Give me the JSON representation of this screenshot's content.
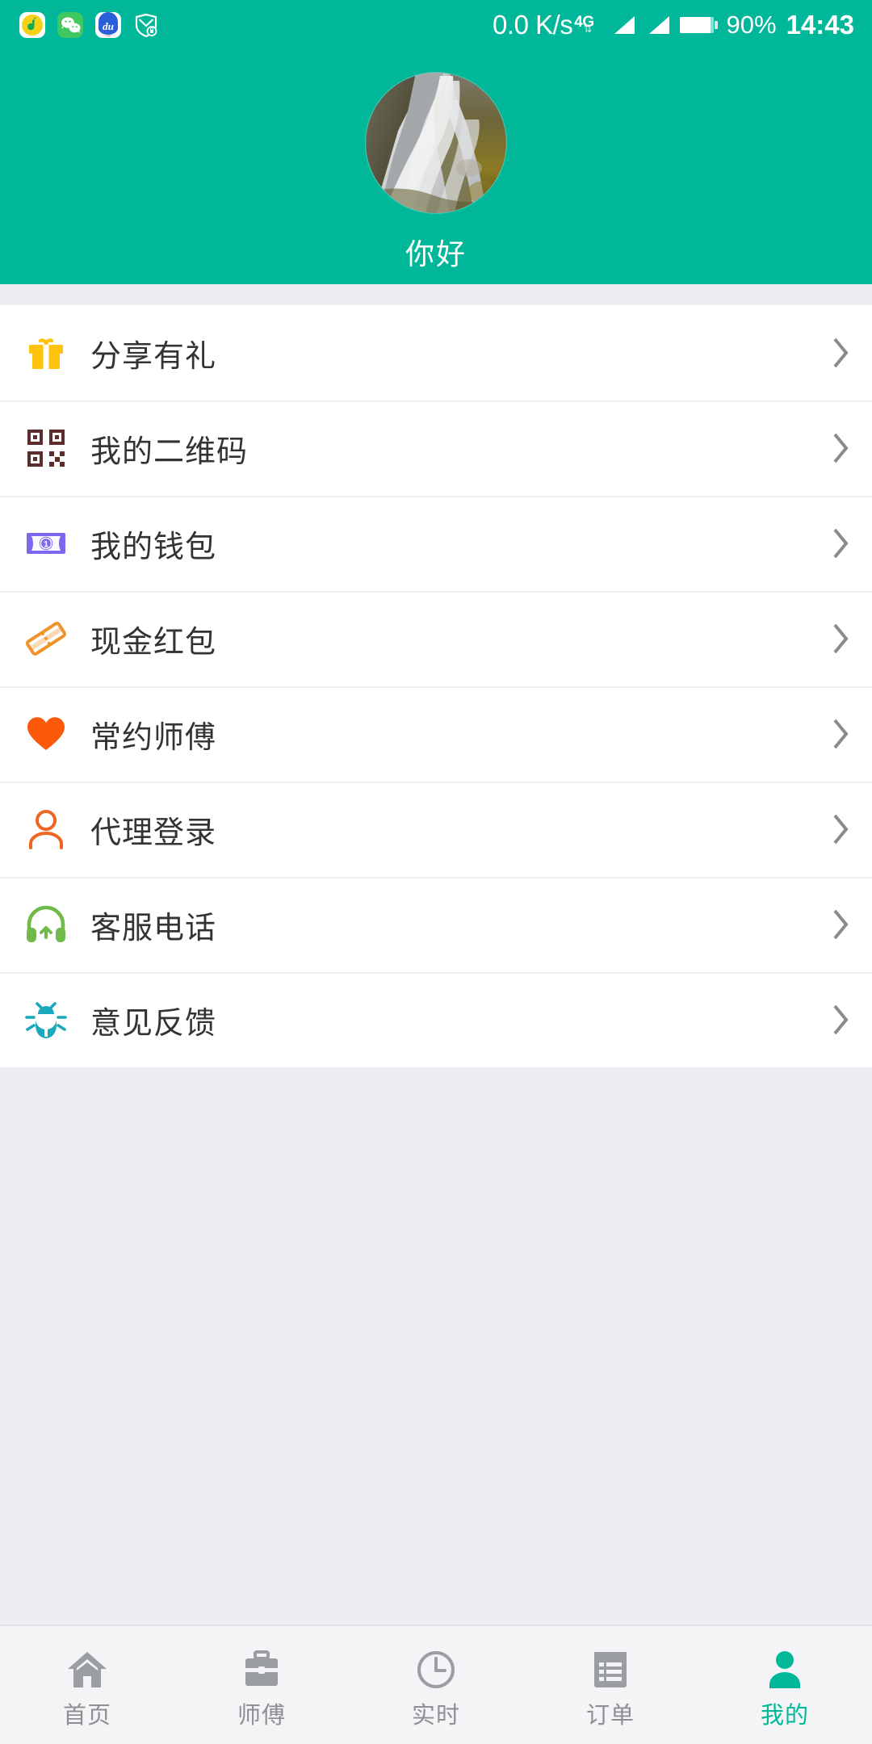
{
  "theme": {
    "brand_green": "#00b899",
    "page_bg": "#eeeef2",
    "list_bg": "#ffffff",
    "label_color": "#333333",
    "tab_inactive": "#8d8f93",
    "tab_active": "#00b899"
  },
  "status_bar": {
    "left_icons": [
      {
        "name": "qq-music-icon",
        "label": "QQ音乐"
      },
      {
        "name": "wechat-icon",
        "label": "微信"
      },
      {
        "name": "baidu-icon",
        "label": "百度"
      },
      {
        "name": "security-shield-icon",
        "label": "安全"
      }
    ],
    "network_speed": "0.0 K/s",
    "network_type": "4G",
    "battery_percent": "90%",
    "time": "14:43"
  },
  "header": {
    "avatar_name": "user-avatar",
    "avatar_description": "waterfall photo",
    "greeting": "你好"
  },
  "menu": {
    "items": [
      {
        "key": "share-gift",
        "icon": "gift-icon",
        "icon_color": "#ffc20e",
        "label": "分享有礼",
        "chevron": "›"
      },
      {
        "key": "my-qrcode",
        "icon": "qrcode-icon",
        "icon_color": "#5c2d2d",
        "label": "我的二维码",
        "chevron": "›"
      },
      {
        "key": "my-wallet",
        "icon": "banknote-icon",
        "icon_color": "#7b68ee",
        "label": "我的钱包",
        "chevron": "›"
      },
      {
        "key": "cash-coupon",
        "icon": "coupon-icon",
        "icon_color": "#f0932b",
        "label": "现金红包",
        "chevron": "›"
      },
      {
        "key": "favorite-master",
        "icon": "heart-icon",
        "icon_color": "#fa5a0a",
        "label": "常约师傅",
        "chevron": "›"
      },
      {
        "key": "agent-login",
        "icon": "person-outline-icon",
        "icon_color": "#ee6622",
        "label": "代理登录",
        "chevron": "›"
      },
      {
        "key": "service-phone",
        "icon": "headset-icon",
        "icon_color": "#6fba4a",
        "label": "客服电话",
        "chevron": "›"
      },
      {
        "key": "feedback",
        "icon": "bug-icon",
        "icon_color": "#19a9bb",
        "label": "意见反馈",
        "chevron": "›"
      }
    ]
  },
  "tabbar": {
    "items": [
      {
        "key": "home",
        "icon": "home-icon",
        "label": "首页",
        "active": false
      },
      {
        "key": "master",
        "icon": "briefcase-icon",
        "label": "师傅",
        "active": false
      },
      {
        "key": "realtime",
        "icon": "clock-icon",
        "label": "实时",
        "active": false
      },
      {
        "key": "orders",
        "icon": "list-icon",
        "label": "订单",
        "active": false
      },
      {
        "key": "mine",
        "icon": "person-icon",
        "label": "我的",
        "active": true
      }
    ]
  }
}
